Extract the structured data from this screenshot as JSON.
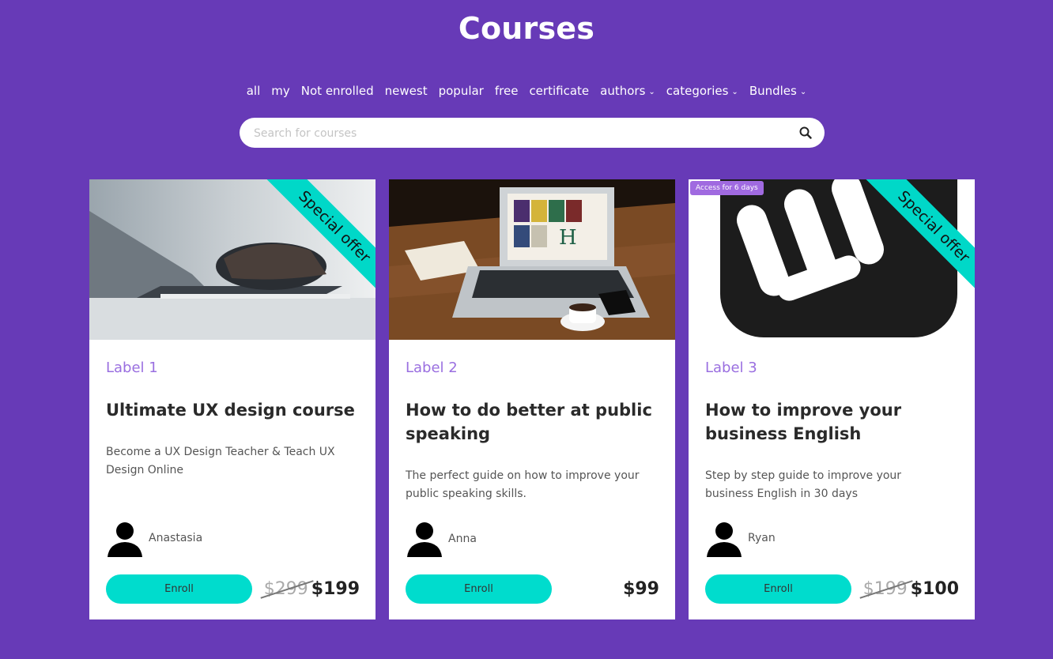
{
  "page": {
    "title": "Courses"
  },
  "filters": [
    {
      "label": "all",
      "dropdown": false
    },
    {
      "label": "my",
      "dropdown": false
    },
    {
      "label": "Not enrolled",
      "dropdown": false
    },
    {
      "label": "newest",
      "dropdown": false
    },
    {
      "label": "popular",
      "dropdown": false
    },
    {
      "label": "free",
      "dropdown": false
    },
    {
      "label": "certificate",
      "dropdown": false
    },
    {
      "label": "authors",
      "dropdown": true
    },
    {
      "label": "categories",
      "dropdown": true
    },
    {
      "label": "Bundles",
      "dropdown": true
    }
  ],
  "search": {
    "placeholder": "Search for courses",
    "value": ""
  },
  "cards": [
    {
      "label": "Label 1",
      "title": "Ultimate UX design course",
      "description": "Become a UX Design Teacher & Teach UX Design Online",
      "author": "Anastasia",
      "enroll": "Enroll",
      "old_price": "$299",
      "price": "$199",
      "ribbon": "Special offer",
      "access": ""
    },
    {
      "label": "Label 2",
      "title": "How to do better at public speaking",
      "description": "The perfect guide on how to improve your public speaking skills.",
      "author": "Anna",
      "enroll": "Enroll",
      "old_price": "",
      "price": "$99",
      "ribbon": "",
      "access": ""
    },
    {
      "label": "Label 3",
      "title": "How to improve your business English",
      "description": "Step by step guide to improve your business English in 30 days",
      "author": "Ryan",
      "enroll": "Enroll",
      "old_price": "$199",
      "price": "$100",
      "ribbon": "Special offer",
      "access": "Access for 6 days"
    }
  ],
  "colors": {
    "background": "#673ab7",
    "accent": "#00dccd",
    "label": "#9a6fe0"
  }
}
